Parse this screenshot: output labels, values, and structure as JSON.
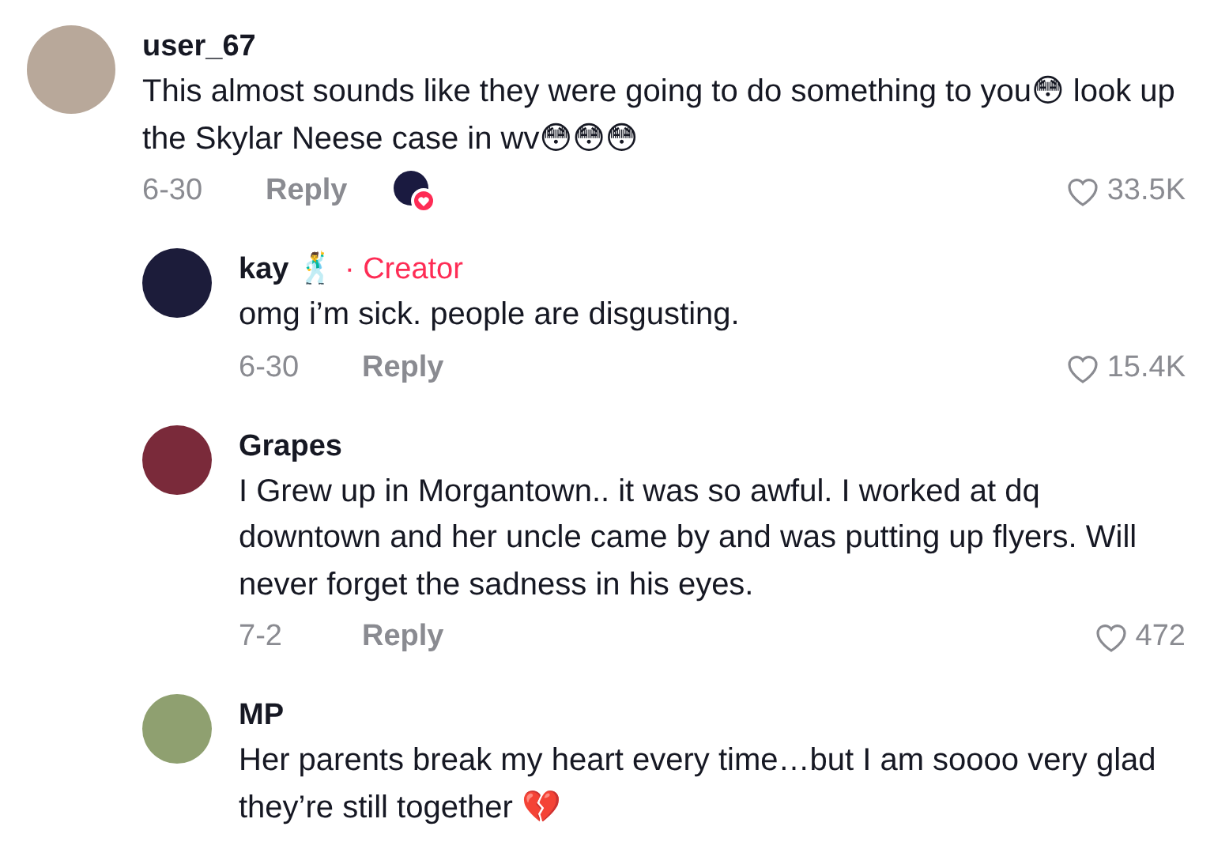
{
  "comments": [
    {
      "user": "user_67",
      "text": "This almost sounds like they were going to do something to you😳 look up the Skylar Neese case in wv😳😳😳",
      "date": "6-30",
      "reply_label": "Reply",
      "liked_by_creator": true,
      "likes": "33.5K",
      "children": [
        {
          "user": "kay 🕺",
          "badge": "· Creator",
          "text": "omg i’m sick. people are disgusting.",
          "date": "6-30",
          "reply_label": "Reply",
          "likes": "15.4K"
        },
        {
          "user": "Grapes",
          "text": "I Grew up in Morgantown.. it was so awful. I worked at dq downtown and her uncle came by and was putting up flyers. Will never forget the sadness in his eyes.",
          "date": "7-2",
          "reply_label": "Reply",
          "likes": "472"
        },
        {
          "user": "MP",
          "text": "Her parents break my heart every time…but I am soooo very glad they’re still together 💔"
        }
      ]
    }
  ]
}
